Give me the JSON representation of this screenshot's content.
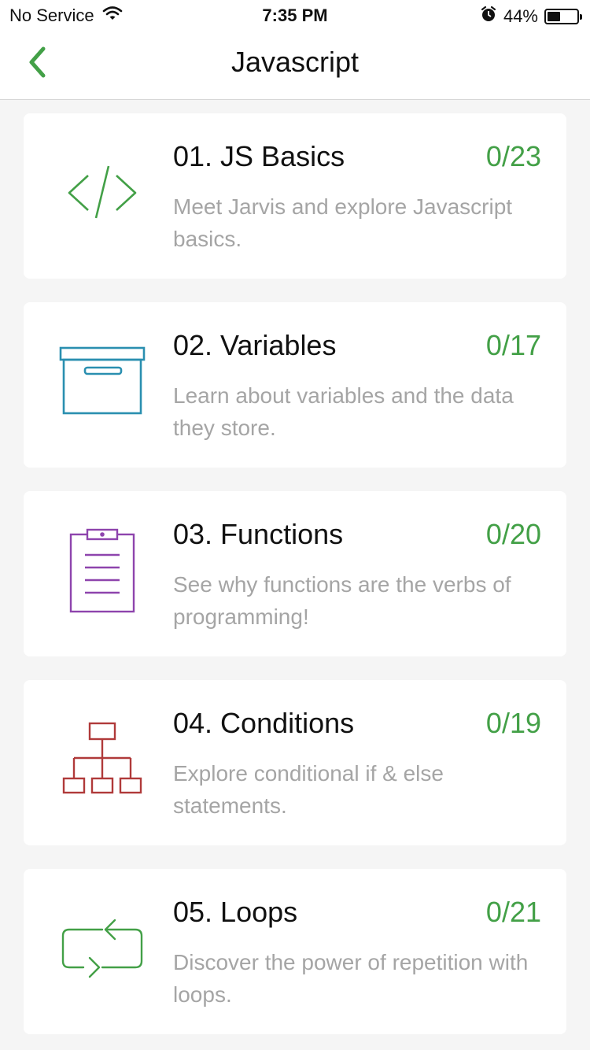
{
  "status_bar": {
    "carrier": "No Service",
    "time": "7:35 PM",
    "battery_text": "44%",
    "battery_level": 0.44
  },
  "nav": {
    "title": "Javascript",
    "accent_color": "#43a047"
  },
  "courses": [
    {
      "title": "01. JS Basics",
      "count": "0/23",
      "description": "Meet Jarvis and explore Javascript basics.",
      "icon": "code-brackets-icon",
      "icon_color": "#43a047"
    },
    {
      "title": "02. Variables",
      "count": "0/17",
      "description": "Learn about variables and the data they store.",
      "icon": "storage-box-icon",
      "icon_color": "#2a8fb0"
    },
    {
      "title": "03. Functions",
      "count": "0/20",
      "description": "See why functions are the verbs of programming!",
      "icon": "clipboard-icon",
      "icon_color": "#8e44ad"
    },
    {
      "title": "04. Conditions",
      "count": "0/19",
      "description": "Explore conditional if & else statements.",
      "icon": "hierarchy-tree-icon",
      "icon_color": "#b03a3a"
    },
    {
      "title": "05. Loops",
      "count": "0/21",
      "description": "Discover the power of repetition with loops.",
      "icon": "loop-arrows-icon",
      "icon_color": "#43a047"
    }
  ]
}
